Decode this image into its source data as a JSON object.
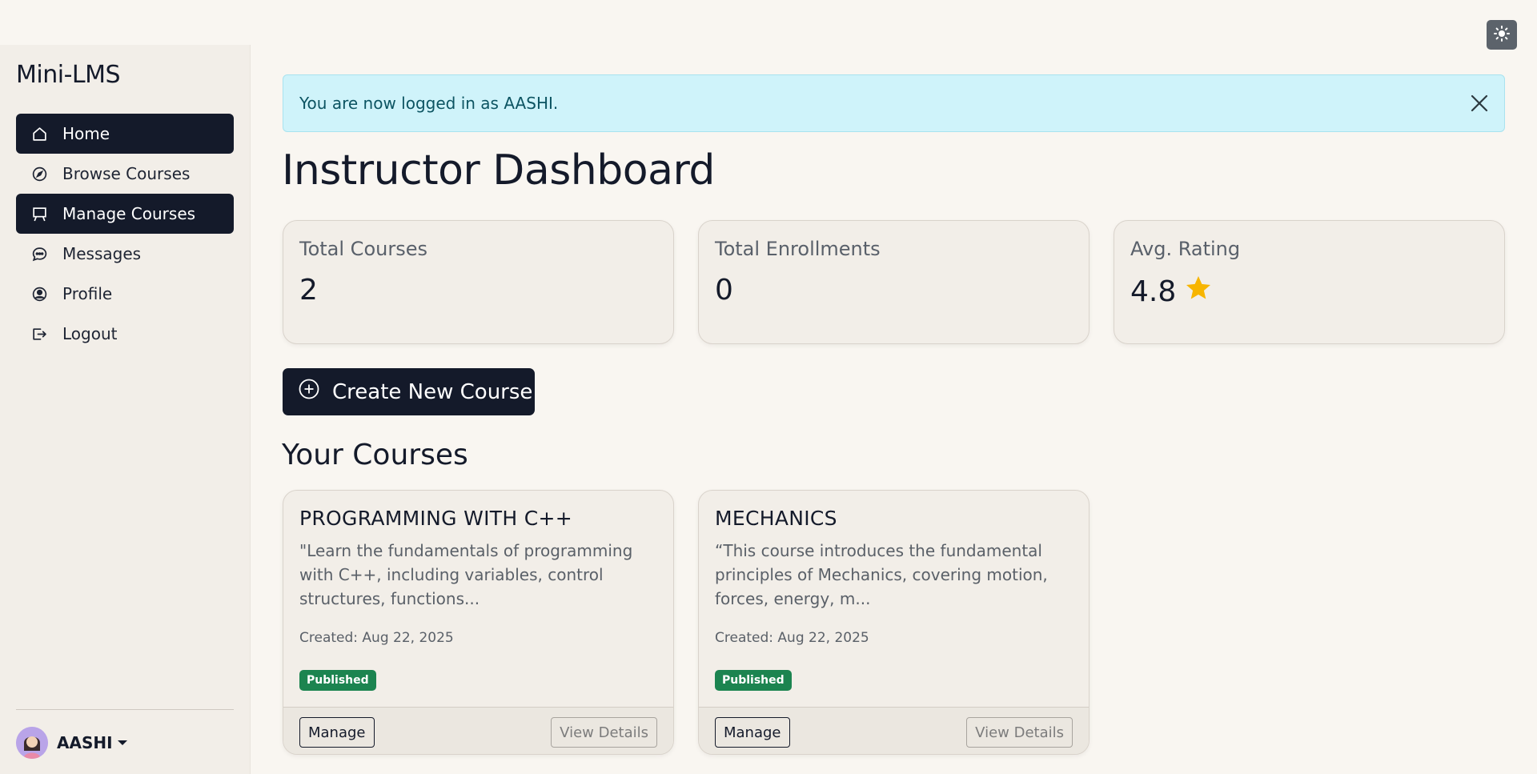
{
  "brand": "Mini-LMS",
  "theme_toggle_icon": "sun-icon",
  "sidebar": {
    "items": [
      {
        "label": "Home",
        "icon": "home-icon",
        "active": true
      },
      {
        "label": "Browse Courses",
        "icon": "compass-icon",
        "active": false
      },
      {
        "label": "Manage Courses",
        "icon": "easel-icon",
        "active": true
      },
      {
        "label": "Messages",
        "icon": "chat-icon",
        "active": false
      },
      {
        "label": "Profile",
        "icon": "user-circle-icon",
        "active": false
      },
      {
        "label": "Logout",
        "icon": "logout-icon",
        "active": false
      }
    ],
    "user": {
      "name": "AASHI"
    }
  },
  "alert": {
    "text": "You are now logged in as AASHI."
  },
  "page_title": "Instructor Dashboard",
  "stats": [
    {
      "label": "Total Courses",
      "value": "2"
    },
    {
      "label": "Total Enrollments",
      "value": "0"
    },
    {
      "label": "Avg. Rating",
      "value": "4.8",
      "icon": "star-icon"
    }
  ],
  "create_button": {
    "label": "Create New Course",
    "icon": "plus-circle-icon"
  },
  "section_title": "Your Courses",
  "courses": [
    {
      "title": "PROGRAMMING WITH C++",
      "description": "\"Learn the fundamentals of programming with C++, including variables, control structures, functions...",
      "created": "Created: Aug 22, 2025",
      "status": "Published",
      "manage_label": "Manage",
      "view_label": "View Details"
    },
    {
      "title": "MECHANICS",
      "description": "“This course introduces the fundamental principles of Mechanics, covering motion, forces, energy, m...",
      "created": "Created: Aug 22, 2025",
      "status": "Published",
      "manage_label": "Manage",
      "view_label": "View Details"
    }
  ],
  "colors": {
    "background": "#f9f6f1",
    "sidebar": "#f2eee8",
    "active_nav": "#141a2a",
    "alert_bg": "#cff3fa",
    "badge_published": "#1c8450",
    "star": "#f7b500"
  }
}
